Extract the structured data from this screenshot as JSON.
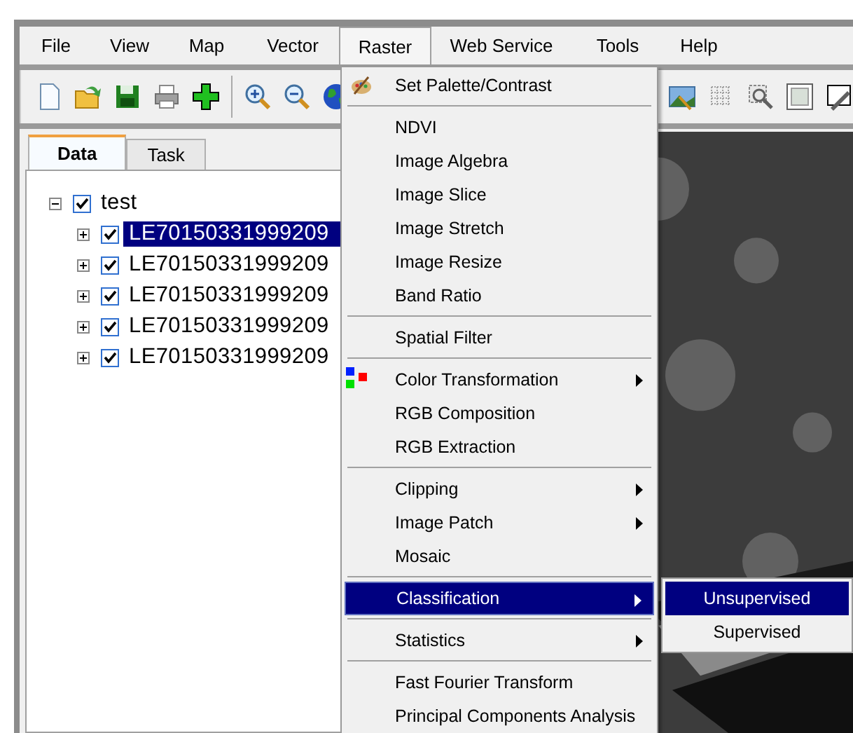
{
  "menu_bar": [
    {
      "label": "File",
      "selected": false
    },
    {
      "label": "View",
      "selected": false
    },
    {
      "label": "Map",
      "selected": false
    },
    {
      "label": "Vector",
      "selected": false
    },
    {
      "label": "Raster",
      "selected": true
    },
    {
      "label": "Web Service",
      "selected": false
    },
    {
      "label": "Tools",
      "selected": false
    },
    {
      "label": "Help",
      "selected": false
    }
  ],
  "tabs": [
    {
      "label": "Data",
      "selected": true
    },
    {
      "label": "Task",
      "selected": false
    }
  ],
  "tree": {
    "label": "test",
    "checked": true,
    "expanded": true,
    "selected": false,
    "children": [
      {
        "label": "LE70150331999209",
        "checked": true,
        "expanded": false,
        "selected": true
      },
      {
        "label": "LE70150331999209",
        "checked": true,
        "expanded": false,
        "selected": false
      },
      {
        "label": "LE70150331999209",
        "checked": true,
        "expanded": false,
        "selected": false
      },
      {
        "label": "LE70150331999209",
        "checked": true,
        "expanded": false,
        "selected": false
      },
      {
        "label": "LE70150331999209",
        "checked": true,
        "expanded": false,
        "selected": false
      }
    ]
  },
  "raster_menu": {
    "groups": [
      [
        {
          "label": "Set Palette/Contrast",
          "kind": "palette",
          "has_submenu": false,
          "selected": false
        }
      ],
      [
        {
          "label": "NDVI",
          "kind": "plain",
          "has_submenu": false,
          "selected": false
        },
        {
          "label": "Image Algebra",
          "kind": "plain",
          "has_submenu": false,
          "selected": false
        },
        {
          "label": "Image Slice",
          "kind": "plain",
          "has_submenu": false,
          "selected": false
        },
        {
          "label": "Image Stretch",
          "kind": "plain",
          "has_submenu": false,
          "selected": false
        },
        {
          "label": "Image Resize",
          "kind": "plain",
          "has_submenu": false,
          "selected": false
        },
        {
          "label": "Band Ratio",
          "kind": "plain",
          "has_submenu": false,
          "selected": false
        }
      ],
      [
        {
          "label": "Spatial Filter",
          "kind": "plain",
          "has_submenu": false,
          "selected": false
        }
      ],
      [
        {
          "label": "Color Transformation",
          "kind": "rgb",
          "has_submenu": true,
          "selected": false
        },
        {
          "label": "RGB Composition",
          "kind": "plain",
          "has_submenu": false,
          "selected": false
        },
        {
          "label": "RGB Extraction",
          "kind": "plain",
          "has_submenu": false,
          "selected": false
        }
      ],
      [
        {
          "label": "Clipping",
          "kind": "plain",
          "has_submenu": true,
          "selected": false
        },
        {
          "label": "Image Patch",
          "kind": "plain",
          "has_submenu": true,
          "selected": false
        },
        {
          "label": "Mosaic",
          "kind": "plain",
          "has_submenu": false,
          "selected": false
        }
      ],
      [
        {
          "label": "Classification",
          "kind": "plain",
          "has_submenu": true,
          "selected": true
        }
      ],
      [
        {
          "label": "Statistics",
          "kind": "plain",
          "has_submenu": true,
          "selected": false
        }
      ],
      [
        {
          "label": "Fast Fourier Transform",
          "kind": "plain",
          "has_submenu": false,
          "selected": false
        },
        {
          "label": "Principal Components Analysis",
          "kind": "plain",
          "has_submenu": false,
          "selected": false
        }
      ]
    ]
  },
  "classification_submenu": [
    {
      "label": "Unsupervised",
      "selected": true
    },
    {
      "label": "Supervised",
      "selected": false
    }
  ]
}
